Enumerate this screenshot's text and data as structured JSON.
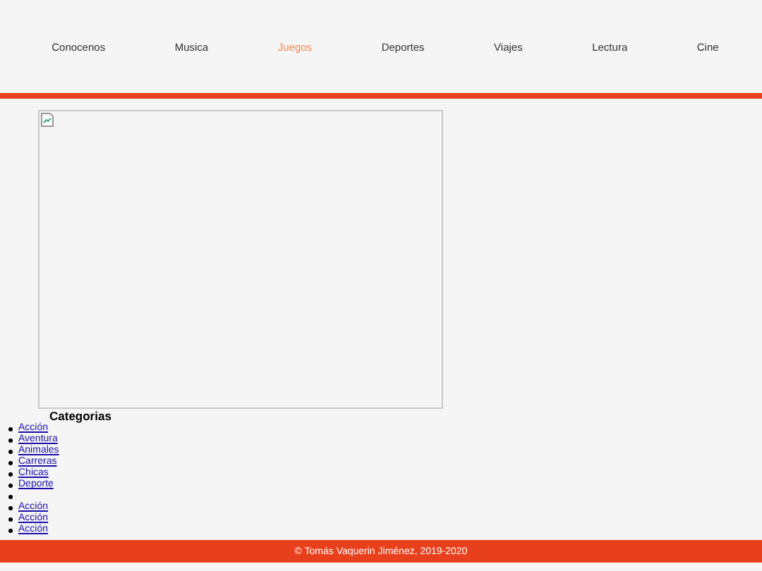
{
  "nav": [
    {
      "label": "Conocenos",
      "selected": false
    },
    {
      "label": "Musica",
      "selected": false
    },
    {
      "label": "Juegos",
      "selected": true
    },
    {
      "label": "Deportes",
      "selected": false
    },
    {
      "label": "Viajes",
      "selected": false
    },
    {
      "label": "Lectura",
      "selected": false
    },
    {
      "label": "Cine",
      "selected": false
    }
  ],
  "image": {
    "kind": "broken"
  },
  "categories": {
    "title": "Categorias",
    "items": [
      {
        "kind": "link",
        "label": "Acción"
      },
      {
        "kind": "link",
        "label": "Aventura"
      },
      {
        "kind": "link",
        "label": "Animales"
      },
      {
        "kind": "link",
        "label": "Carreras"
      },
      {
        "kind": "link",
        "label": "Chicas"
      },
      {
        "kind": "link",
        "label": "Deporte"
      },
      {
        "kind": "empty"
      },
      {
        "kind": "link",
        "label": "Acción"
      },
      {
        "kind": "link",
        "label": "Acción"
      },
      {
        "kind": "link",
        "label": "Acción"
      }
    ]
  },
  "footer": "© Tomás Vaquerin Jiménez, 2019-2020"
}
